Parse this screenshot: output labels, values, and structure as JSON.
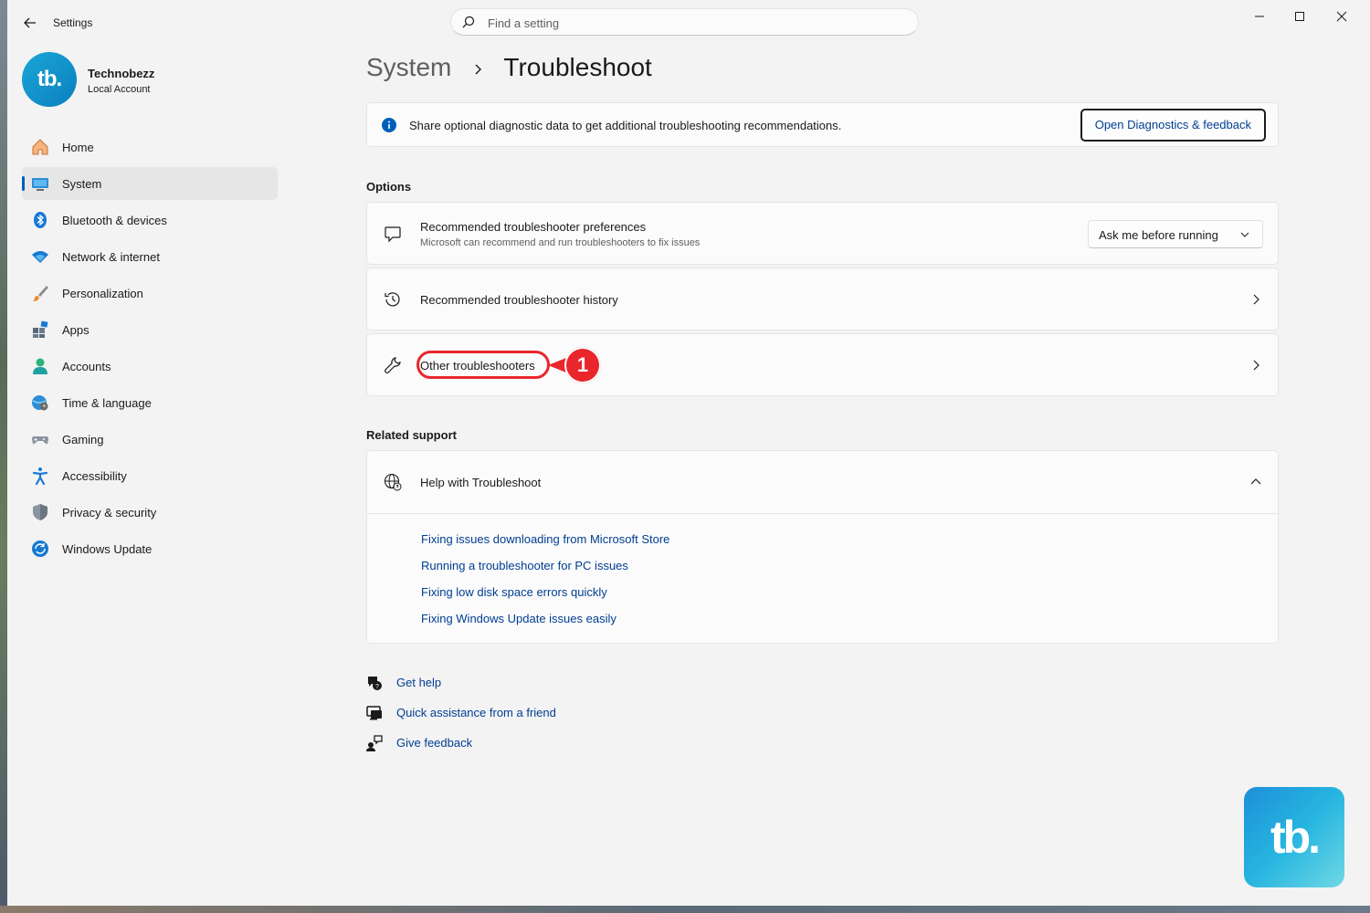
{
  "window": {
    "app_title": "Settings",
    "search_placeholder": "Find a setting"
  },
  "profile": {
    "avatar_text": "tb.",
    "name": "Technobezz",
    "account_type": "Local Account"
  },
  "sidebar": {
    "items": [
      {
        "label": "Home",
        "icon": "home-icon"
      },
      {
        "label": "System",
        "icon": "system-icon",
        "active": true
      },
      {
        "label": "Bluetooth & devices",
        "icon": "bluetooth-icon"
      },
      {
        "label": "Network & internet",
        "icon": "wifi-icon"
      },
      {
        "label": "Personalization",
        "icon": "brush-icon"
      },
      {
        "label": "Apps",
        "icon": "apps-icon"
      },
      {
        "label": "Accounts",
        "icon": "accounts-icon"
      },
      {
        "label": "Time & language",
        "icon": "globe-clock-icon"
      },
      {
        "label": "Gaming",
        "icon": "gamepad-icon"
      },
      {
        "label": "Accessibility",
        "icon": "accessibility-icon"
      },
      {
        "label": "Privacy & security",
        "icon": "shield-icon"
      },
      {
        "label": "Windows Update",
        "icon": "update-icon"
      }
    ]
  },
  "breadcrumb": {
    "parent": "System",
    "current": "Troubleshoot"
  },
  "info_banner": {
    "text": "Share optional diagnostic data to get additional troubleshooting recommendations.",
    "button_label": "Open Diagnostics & feedback"
  },
  "options": {
    "heading": "Options",
    "preferences": {
      "title": "Recommended troubleshooter preferences",
      "subtitle": "Microsoft can recommend and run troubleshooters to fix issues",
      "dropdown_value": "Ask me before running"
    },
    "history": {
      "title": "Recommended troubleshooter history"
    },
    "other": {
      "title": "Other troubleshooters",
      "step_number": "1"
    }
  },
  "related_support": {
    "heading": "Related support",
    "help_title": "Help with Troubleshoot",
    "links": [
      "Fixing issues downloading from Microsoft Store",
      "Running a troubleshooter for PC issues",
      "Fixing low disk space errors quickly",
      "Fixing Windows Update issues easily"
    ]
  },
  "footer_links": {
    "get_help": "Get help",
    "quick_assist": "Quick assistance from a friend",
    "feedback": "Give feedback"
  },
  "brand_logo_text": "tb.",
  "colors": {
    "accent": "#005fb8",
    "link": "#003e92",
    "highlight": "#e8262c"
  }
}
